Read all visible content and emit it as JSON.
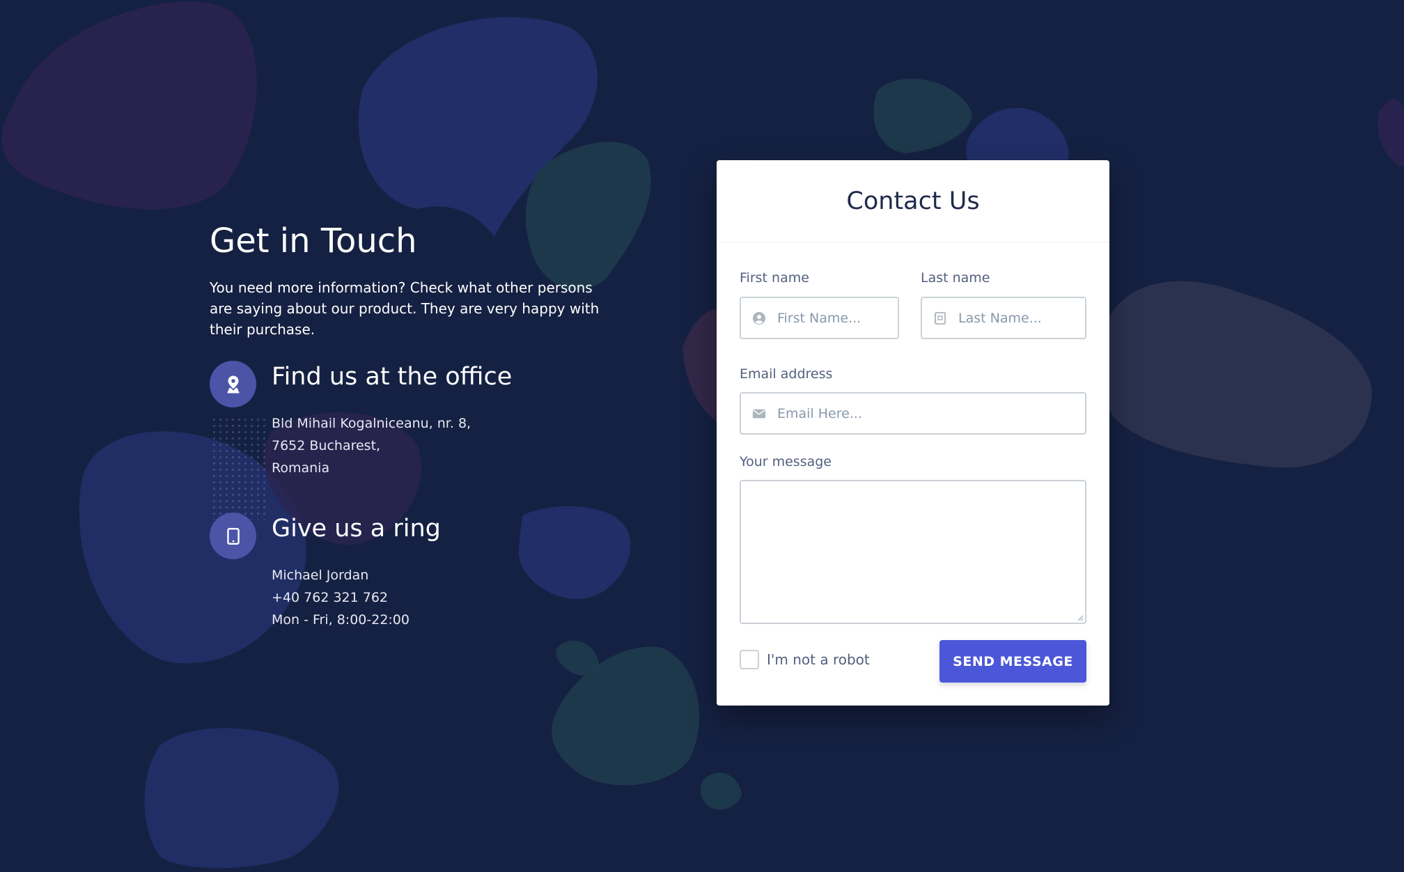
{
  "colors": {
    "background": "#152142",
    "accent": "#4b57d8",
    "icon_circle": "#4c54a8",
    "card": "#ffffff"
  },
  "info": {
    "title": "Get in Touch",
    "description": "You need more information? Check what other persons are saying about our product. They are very happy with their purchase.",
    "office": {
      "icon": "map-pin-icon",
      "title": "Find us at the office",
      "lines": [
        "Bld Mihail Kogalniceanu, nr. 8,",
        "7652 Bucharest,",
        "Romania"
      ]
    },
    "ring": {
      "icon": "tablet-icon",
      "title": "Give us a ring",
      "lines": [
        "Michael Jordan",
        "+40 762 321 762",
        "Mon - Fri, 8:00-22:00"
      ]
    }
  },
  "form": {
    "title": "Contact Us",
    "first_name": {
      "label": "First name",
      "placeholder": "First Name...",
      "icon": "user-circle-icon"
    },
    "last_name": {
      "label": "Last name",
      "placeholder": "Last Name...",
      "icon": "id-card-icon"
    },
    "email": {
      "label": "Email address",
      "placeholder": "Email Here...",
      "icon": "envelope-icon"
    },
    "message": {
      "label": "Your message",
      "value": ""
    },
    "robot_check": {
      "label": "I'm not a robot",
      "checked": false
    },
    "submit_label": "SEND MESSAGE"
  }
}
